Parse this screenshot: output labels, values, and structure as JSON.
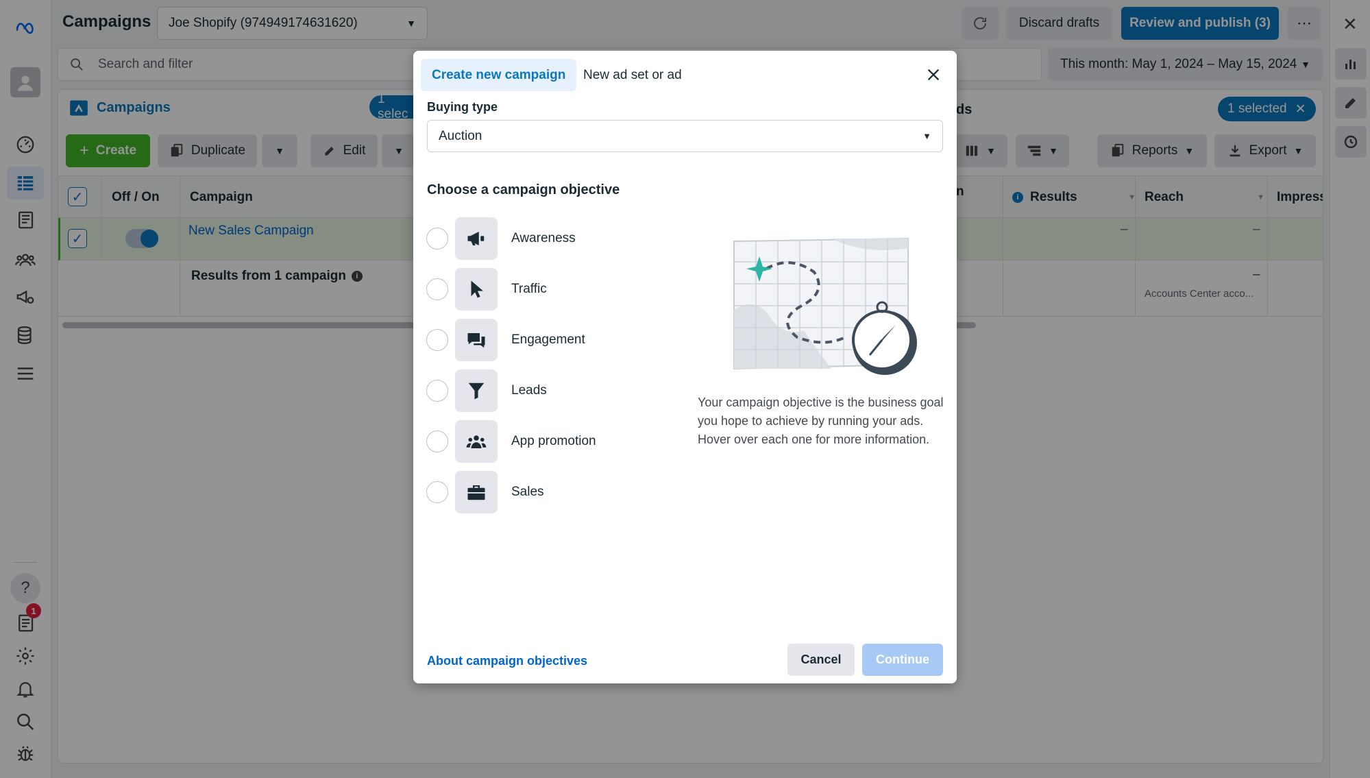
{
  "header": {
    "title": "Campaigns",
    "account": "Joe Shopify (974949174631620)",
    "discard": "Discard drafts",
    "review": "Review and publish (3)",
    "search_placeholder": "Search and filter",
    "date_range": "This month: May 1, 2024 – May 15, 2024"
  },
  "left_nav": {
    "notification_count": "1"
  },
  "campaigns_card": {
    "tab_label": "Campaigns",
    "selected_left": "1 selec",
    "selected_right": "1 selected",
    "partial_tab": "ds",
    "toolbar": {
      "create": "Create",
      "duplicate": "Duplicate",
      "edit": "Edit",
      "reports": "Reports",
      "export": "Export"
    },
    "columns": {
      "offon": "Off / On",
      "campaign": "Campaign",
      "partial": "n",
      "results": "Results",
      "reach": "Reach",
      "impress": "Impress"
    },
    "row": {
      "name": "New Sales Campaign",
      "results": "–",
      "reach": "–"
    },
    "summary": {
      "label": "Results from 1 campaign",
      "reach": "–",
      "reach_sub": "Accounts Center acco..."
    }
  },
  "modal": {
    "tab_active": "Create new campaign",
    "tab_other": "New ad set or ad",
    "buying_type_label": "Buying type",
    "buying_type_value": "Auction",
    "objective_heading": "Choose a campaign objective",
    "objectives": [
      {
        "label": "Awareness",
        "icon": "megaphone-icon"
      },
      {
        "label": "Traffic",
        "icon": "cursor-icon"
      },
      {
        "label": "Engagement",
        "icon": "chat-bubbles-icon"
      },
      {
        "label": "Leads",
        "icon": "funnel-icon"
      },
      {
        "label": "App promotion",
        "icon": "people-icon"
      },
      {
        "label": "Sales",
        "icon": "briefcase-icon"
      }
    ],
    "description": "Your campaign objective is the business goal you hope to achieve by running your ads. Hover over each one for more information.",
    "about_link": "About campaign objectives",
    "cancel": "Cancel",
    "continue": "Continue"
  },
  "colors": {
    "accent": "#0a78be",
    "green": "#42b72a",
    "link": "#0064d1",
    "row_highlight": "#e7f3e1"
  }
}
